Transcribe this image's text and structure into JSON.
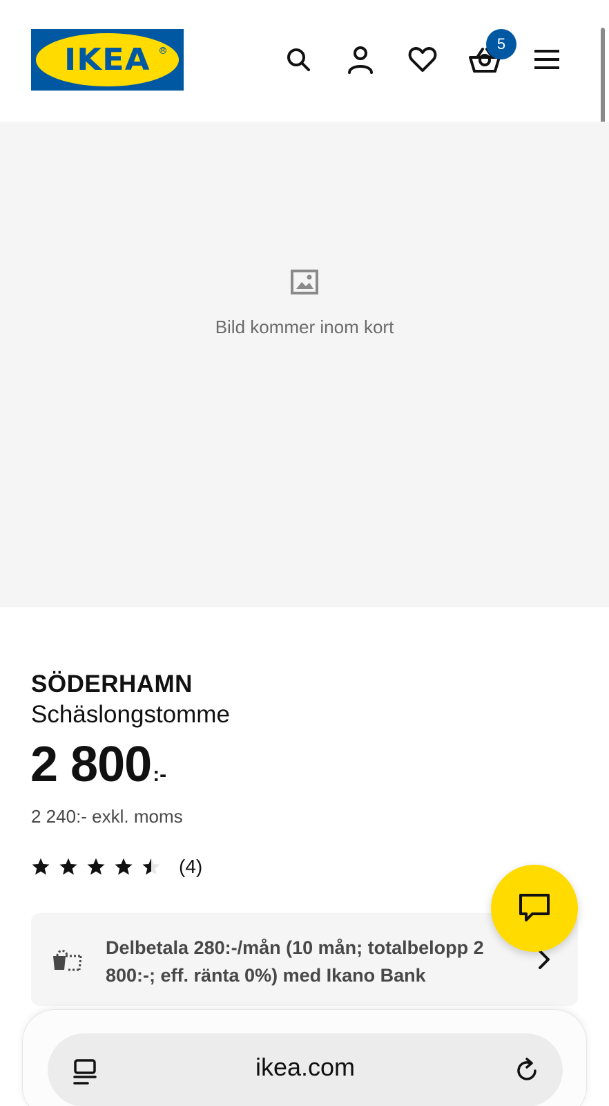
{
  "header": {
    "logo_text": "IKEA",
    "cart_count": "5",
    "icons": [
      "search-icon",
      "account-icon",
      "heart-icon",
      "basket-icon",
      "menu-icon"
    ]
  },
  "image_placeholder": {
    "text": "Bild kommer inom kort"
  },
  "product": {
    "name": "SÖDERHAMN",
    "description": "Schäslongstomme",
    "price": "2 800",
    "price_suffix": ":-",
    "price_excl_vat": "2 240:- exkl. moms",
    "rating": 4.5,
    "rating_max": 5,
    "review_count": "(4)"
  },
  "finance": {
    "text": "Delbetala 280:-/mån (10 mån; totalbelopp 2 800:-; eff. ränta 0%) med Ikano Bank"
  },
  "browser": {
    "url": "ikea.com"
  },
  "colors": {
    "ikea_blue": "#0058a3",
    "ikea_yellow": "#ffdb00",
    "placeholder_bg": "#f5f5f5"
  }
}
